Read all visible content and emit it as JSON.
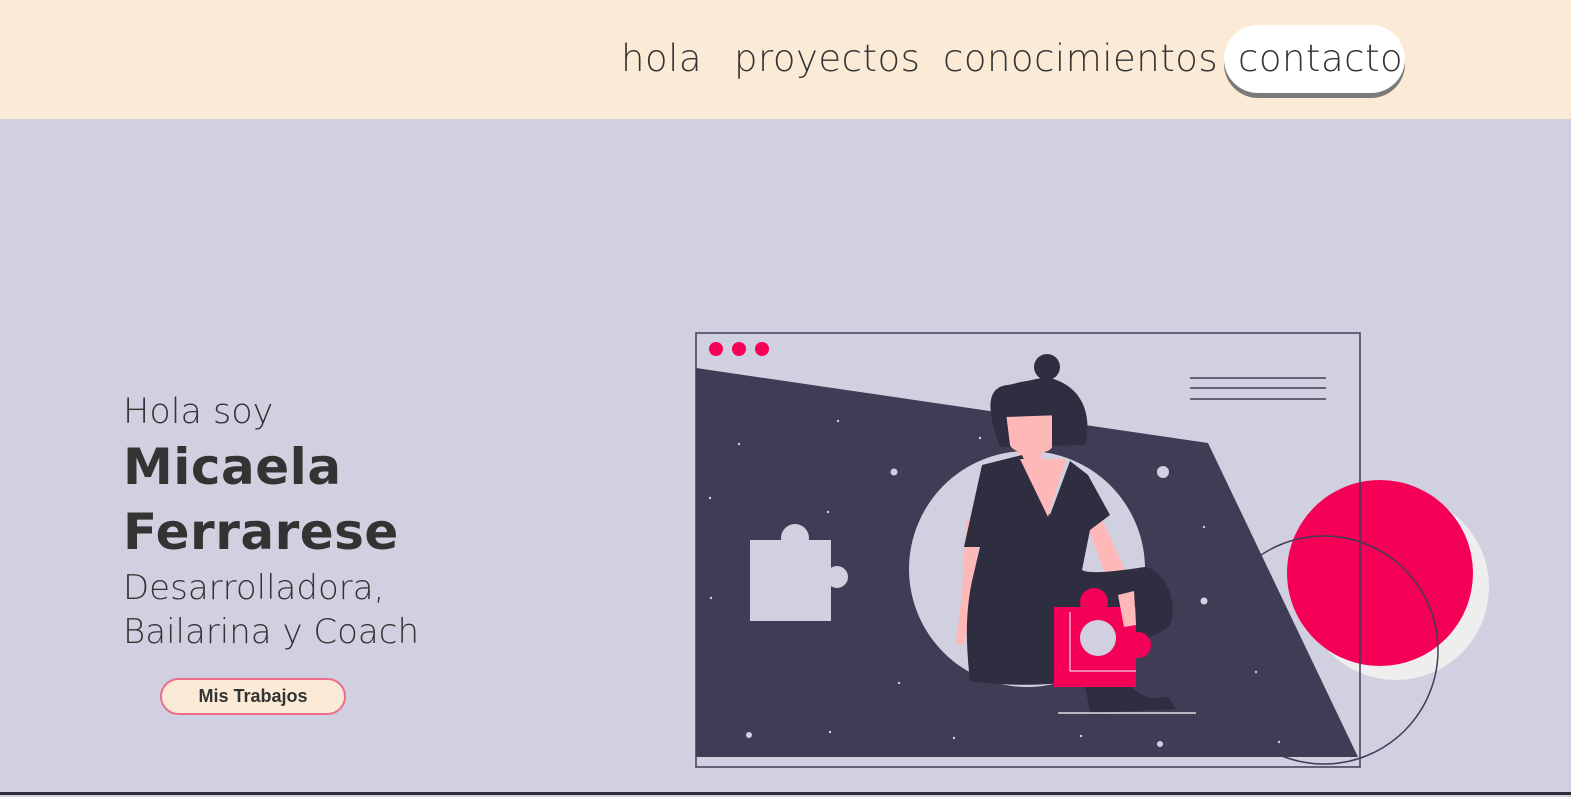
{
  "nav": {
    "items": [
      {
        "label": "hola"
      },
      {
        "label": "proyectos"
      },
      {
        "label": "conocimientos"
      },
      {
        "label": "contacto"
      }
    ]
  },
  "hero": {
    "greeting": "Hola soy",
    "name_first": "Micaela",
    "name_last": "Ferrarese",
    "role_line_1": "Desarrolladora,",
    "role_line_2": "Bailarina y Coach",
    "cta_label": "Mis Trabajos"
  },
  "colors": {
    "header_bg": "#fbebd6",
    "page_bg": "#d1d0e0",
    "text": "#333333",
    "accent_pink": "#f50057",
    "illustration_dark": "#3f3d56"
  }
}
